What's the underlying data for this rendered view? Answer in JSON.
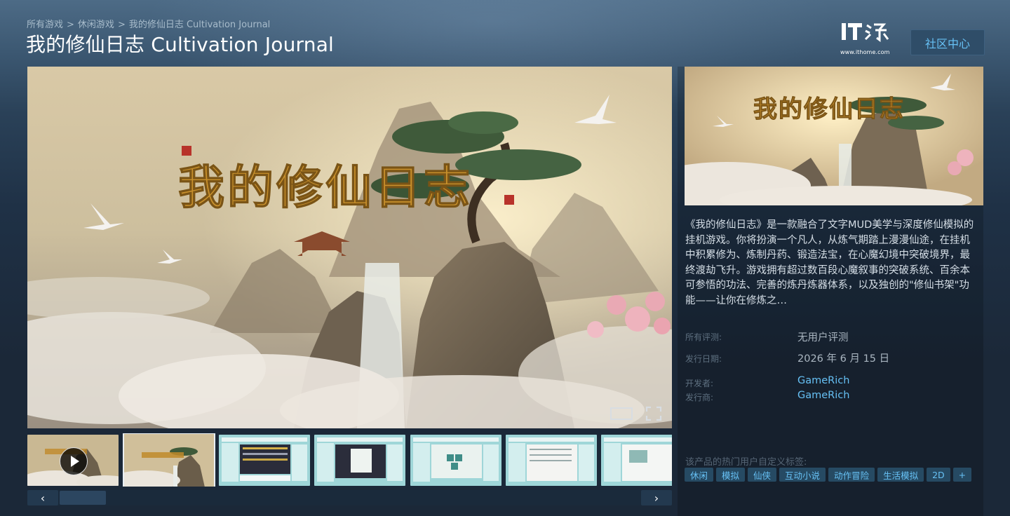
{
  "breadcrumb": {
    "items": [
      "所有游戏",
      "休闲游戏",
      "我的修仙日志 Cultivation Journal"
    ],
    "separator": ">"
  },
  "page_title": "我的修仙日志 Cultivation Journal",
  "watermark": {
    "mark": "IT之家",
    "url": "www.ithome.com"
  },
  "community_button": "社区中心",
  "media": {
    "main_title_art": "我的修仙日志",
    "thumbnails": [
      {
        "kind": "video",
        "selected": false
      },
      {
        "kind": "image",
        "selected": true
      },
      {
        "kind": "screenshot",
        "selected": false
      },
      {
        "kind": "screenshot",
        "selected": false
      },
      {
        "kind": "screenshot",
        "selected": false
      },
      {
        "kind": "screenshot",
        "selected": false
      },
      {
        "kind": "screenshot",
        "selected": false
      }
    ],
    "icons": {
      "theater": "theater-mode-icon",
      "fullscreen": "fullscreen-icon",
      "play": "play-icon",
      "prev": "chevron-left-icon",
      "next": "chevron-right-icon"
    },
    "prev_label": "‹",
    "next_label": "›"
  },
  "capsule_art_title": "我的修仙日志",
  "description": "《我的修仙日志》是一款融合了文字MUD美学与深度修仙模拟的挂机游戏。你将扮演一个凡人，从炼气期踏上漫漫仙途，在挂机中积累修为、炼制丹药、锻造法宝，在心魔幻境中突破境界，最终渡劫飞升。游戏拥有超过数百段心魔叙事的突破系统、百余本可参悟的功法、完善的炼丹炼器体系，以及独创的\"修仙书架\"功能——让你在修炼之…",
  "meta": {
    "reviews_label": "所有评测:",
    "reviews_value": "无用户评测",
    "release_label": "发行日期:",
    "release_value": "2026 年 6 月 15 日",
    "developer_label": "开发者:",
    "developer_value": "GameRich",
    "publisher_label": "发行商:",
    "publisher_value": "GameRich"
  },
  "tags_title": "该产品的热门用户自定义标签:",
  "tags": [
    "休闲",
    "模拟",
    "仙侠",
    "互动小说",
    "动作冒险",
    "生活模拟",
    "2D",
    "+"
  ],
  "colors": {
    "background": "#1b2838",
    "link": "#66c0f4",
    "tag_bg": "#264a63",
    "button_bg": "#2f4d68"
  }
}
